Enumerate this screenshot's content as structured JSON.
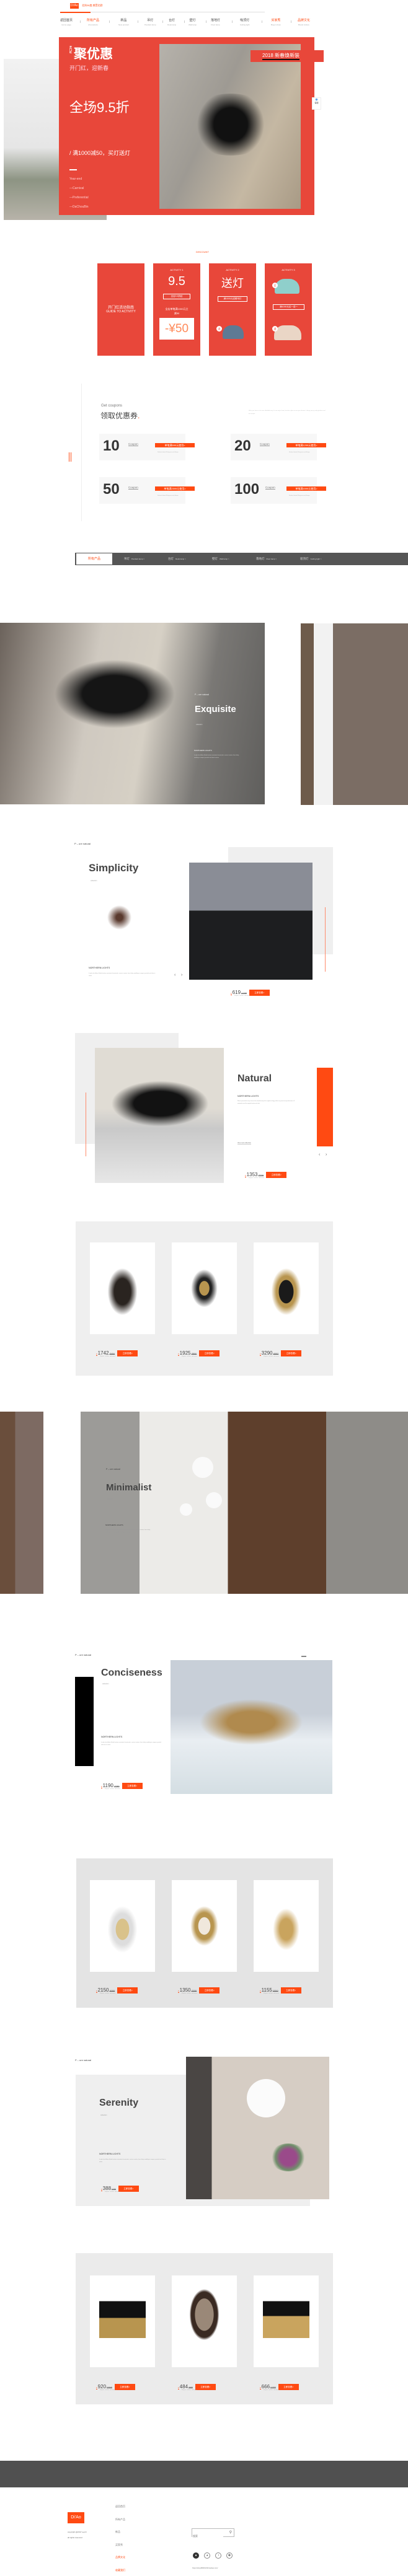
{
  "header": {
    "logo": "Di'Ao",
    "slogan": "北纬38度 感受北欧",
    "accent": "#ff4a12",
    "nav": [
      {
        "cn": "返回首页",
        "en": "Home page"
      },
      {
        "cn": "所有产品",
        "en": "All products",
        "active": true
      },
      {
        "cn": "新品",
        "en": "New product"
      },
      {
        "cn": "吊灯",
        "en": "Pendant lamp"
      },
      {
        "cn": "台灯",
        "en": "Desk lamp"
      },
      {
        "cn": "壁灯",
        "en": "Wall lamp"
      },
      {
        "cn": "落地灯",
        "en": "Floor lamp"
      },
      {
        "cn": "吸顶灯",
        "en": "Ceiling light"
      },
      {
        "cn": "买家秀",
        "en": "Buyer show",
        "active": true
      },
      {
        "cn": "品牌文化",
        "en": "Brand culture",
        "active": true
      }
    ]
  },
  "hero": {
    "small_tag": "开门红",
    "title": "聚优惠",
    "subtitle": "开门红，迎新春",
    "discount": "全场9.5折",
    "offer": "/ 满1000减50，买灯送灯",
    "lines": [
      "Year-end",
      "—Carnival",
      "—Preferential",
      "—DaChouBin"
    ],
    "badge": "2018 新春焕新装",
    "side_widget": "客服",
    "red": "#e8473a"
  },
  "discount": {
    "label": "DISCOUNT",
    "guide_cn": "开门红活动指南",
    "guide_en": "GUIDE TO ACTIVITY",
    "act1": {
      "title": "ACTIVITY 1",
      "big": "9.5",
      "tag": "全店9.5折起",
      "desc": "全店单笔满1000元立减50",
      "amount": "-¥50"
    },
    "act2": {
      "title": "ACTIVITY 2",
      "big": "送灯",
      "tag": "满1000元送餐吊灯",
      "badge": "送"
    },
    "act3": {
      "title": "ACTIVITY 3",
      "tag": "满1000元买一送一",
      "badge_buy": "买",
      "badge_gift": "送"
    }
  },
  "coupons": {
    "en": "Get coupons",
    "cn": "领取优惠券",
    "note": "Make your home in the most affordable way. It is not only a home, but also a place to start your dreams. It brings you joy and joyfulness and free temple.",
    "items": [
      {
        "value": "10",
        "label": "Coupon",
        "btn": "单笔满599元使用>",
        "desc": "Northern latitude 38 degrees north Europe"
      },
      {
        "value": "20",
        "label": "Coupon",
        "btn": "单笔满1299元使用>",
        "desc": "Northern latitude 38 degrees north Europe"
      },
      {
        "value": "50",
        "label": "Coupon",
        "btn": "单笔满2599元使用>",
        "desc": "Northern latitude 38 degrees north Europe"
      },
      {
        "value": "100",
        "label": "Coupon",
        "btn": "单笔满4999元使用>",
        "desc": "Northern latitude 38 degrees north Europe"
      }
    ]
  },
  "tabs": [
    {
      "cn": "所有产品",
      "en": ""
    },
    {
      "cn": "吊灯",
      "en": "Pendant lamp >"
    },
    {
      "cn": "台灯",
      "en": "Desk lamp >"
    },
    {
      "cn": "壁灯",
      "en": "Wall lamp >"
    },
    {
      "cn": "落地灯",
      "en": "Floor lamp >"
    },
    {
      "cn": "吸顶灯",
      "en": "Ceiling light >"
    }
  ],
  "common": {
    "pure": "P – ure natural",
    "collection": "collection",
    "northern": "NORTHERN LIGHTS",
    "desc": "In style also follows Nordic furniture consistent characteristic, succinct concise, line is lively, modeling is compact, practical and close to nature",
    "cta": "立即查看>",
    "sub": "Super value release",
    "yen": "¥"
  },
  "exquisite": {
    "title": "Exquisite"
  },
  "simplicity": {
    "title": "Simplicity",
    "price": "619",
    "old": "/1238"
  },
  "natural": {
    "title": "Natural",
    "desc": "What is presented is very close to the natural beauty of the original ecology, without any unnecessary decoration, all materials reveal the original texture and color.",
    "next": "View next collection",
    "price": "1353",
    "old": "/2706"
  },
  "grid1": [
    {
      "price": "1742",
      "old": "/3484"
    },
    {
      "price": "1925",
      "old": "/3850"
    },
    {
      "price": "3290",
      "old": "/6582"
    }
  ],
  "minimalist": {
    "title": "Minimalist"
  },
  "conciseness": {
    "title": "Conciseness",
    "price": "1190",
    "old": "/2380"
  },
  "grid2": [
    {
      "price": "2150",
      "old": "/4300"
    },
    {
      "price": "1350",
      "old": "/2700"
    },
    {
      "price": "1155",
      "old": "/2310"
    }
  ],
  "serenity": {
    "title": "Serenity",
    "price": "388",
    "old": "/776"
  },
  "grid3": [
    {
      "price": "920",
      "old": "/1840"
    },
    {
      "price": "484",
      "old": "/968"
    },
    {
      "price": "666",
      "old": "/1333"
    }
  ],
  "footer": {
    "logo": "Di'Ao",
    "copyright1": "copyright @2017-a-pril",
    "copyright2": "all rights reserved",
    "links": [
      "返回首页",
      "所有产品",
      "新品",
      "买家秀",
      "品牌文化",
      "收藏我们"
    ],
    "search_placeholder": "搜索",
    "url": "https://shop486391330.taobao.com/",
    "socials": [
      "qq-icon",
      "wechat-icon",
      "weibo-icon",
      "clover-icon"
    ]
  }
}
